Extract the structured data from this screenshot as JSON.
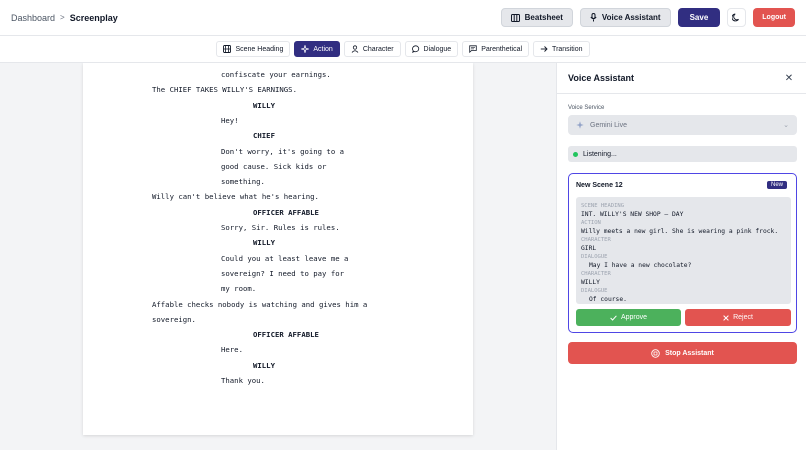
{
  "header": {
    "breadcrumb_root": "Dashboard",
    "breadcrumb_sep": ">",
    "breadcrumb_current": "Screenplay",
    "beatsheet_label": "Beatsheet",
    "voice_assistant_label": "Voice Assistant",
    "save_label": "Save",
    "logout_label": "Logout"
  },
  "toolbar": {
    "items": [
      {
        "label": "Scene Heading",
        "icon": "film-icon"
      },
      {
        "label": "Action",
        "icon": "sparkle-icon"
      },
      {
        "label": "Character",
        "icon": "user-icon"
      },
      {
        "label": "Dialogue",
        "icon": "speech-bubble-icon"
      },
      {
        "label": "Parenthetical",
        "icon": "message-square-icon"
      },
      {
        "label": "Transition",
        "icon": "arrow-right-icon"
      }
    ],
    "active": "Action"
  },
  "script": {
    "lines": [
      {
        "type": "dialogue",
        "text": "confiscate your earnings."
      },
      {
        "type": "action",
        "text": "The CHIEF TAKES WILLY'S EARNINGS."
      },
      {
        "type": "char",
        "text": "WILLY"
      },
      {
        "type": "dialogue",
        "text": "Hey!"
      },
      {
        "type": "char",
        "text": "CHIEF"
      },
      {
        "type": "dialogue",
        "text": "Don't worry, it's going to a"
      },
      {
        "type": "dialogue",
        "text": "good cause. Sick kids or"
      },
      {
        "type": "dialogue",
        "text": "something."
      },
      {
        "type": "action",
        "text": "Willy can't believe what he's hearing."
      },
      {
        "type": "char",
        "text": "OFFICER AFFABLE"
      },
      {
        "type": "dialogue",
        "text": "Sorry, Sir. Rules is rules."
      },
      {
        "type": "char",
        "text": "WILLY"
      },
      {
        "type": "dialogue",
        "text": "Could you at least leave me a"
      },
      {
        "type": "dialogue",
        "text": "sovereign? I need to pay for"
      },
      {
        "type": "dialogue",
        "text": "my room."
      },
      {
        "type": "action",
        "text": "Affable checks nobody is watching and gives him a"
      },
      {
        "type": "action",
        "text": "sovereign."
      },
      {
        "type": "char",
        "text": "OFFICER AFFABLE"
      },
      {
        "type": "dialogue",
        "text": "Here."
      },
      {
        "type": "char",
        "text": "WILLY"
      },
      {
        "type": "dialogue",
        "text": "Thank you."
      }
    ]
  },
  "panel": {
    "title": "Voice Assistant",
    "service_label": "Voice Service",
    "service_value": "Gemini Live",
    "status_text": "Listening...",
    "scene": {
      "title": "New Scene 12",
      "badge": "New",
      "blocks": [
        {
          "label": "SCENE HEADING",
          "value": "INT. WILLY'S NEW SHOP – DAY",
          "indent": false
        },
        {
          "label": "ACTION",
          "value": "Willy meets a new girl. She is wearing a pink frock.",
          "indent": false
        },
        {
          "label": "CHARACTER",
          "value": "GIRL",
          "indent": false
        },
        {
          "label": "DIALOGUE",
          "value": "May I have a new chocolate?",
          "indent": true
        },
        {
          "label": "CHARACTER",
          "value": "WILLY",
          "indent": false
        },
        {
          "label": "DIALOGUE",
          "value": "Of course.",
          "indent": true
        }
      ],
      "approve_label": "Approve",
      "reject_label": "Reject"
    },
    "stop_label": "Stop Assistant"
  },
  "colors": {
    "primary": "#312e81",
    "danger": "#e25450",
    "success": "#4cb15c",
    "listening": "#22c55e"
  }
}
